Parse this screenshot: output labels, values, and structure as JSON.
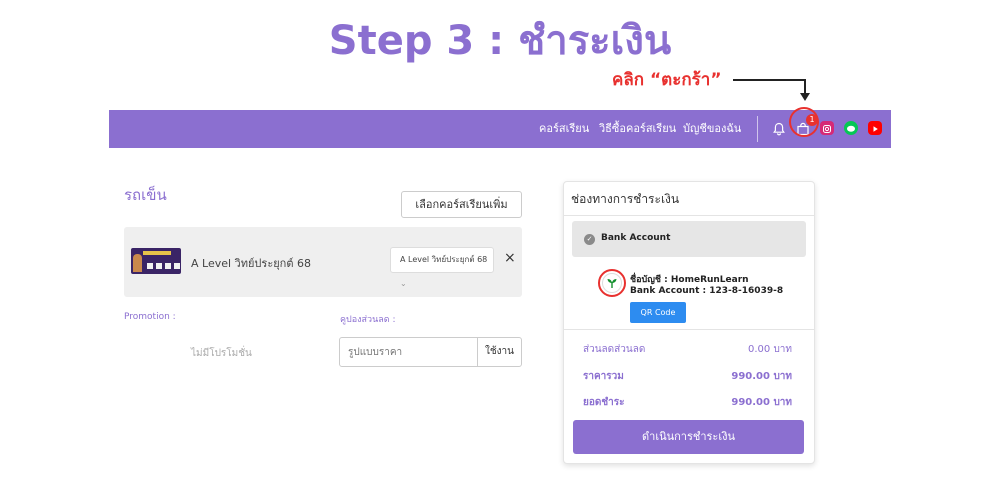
{
  "heading": {
    "title": "Step 3 : ชำระเงิน"
  },
  "annotation": {
    "text": "คลิก “ตะกร้า”",
    "color": "#e8312f"
  },
  "colors": {
    "brand": "#8b6fd0",
    "qr_button": "#2d8cf0"
  },
  "navbar": {
    "links": [
      "คอร์สเรียน",
      "วิธีซื้อคอร์สเรียน",
      "บัญชีของฉัน"
    ],
    "icons": [
      "bell-icon",
      "shopping-bag-icon",
      "instagram-icon",
      "line-icon",
      "youtube-icon"
    ],
    "cart_badge": "1"
  },
  "cart": {
    "title": "รถเข็น",
    "add_course_label": "เลือกคอร์สเรียนเพิ่ม",
    "item": {
      "name": "A Level วิทย์ประยุกต์ 68",
      "selected_option": "A Level วิทย์ประยุกต์ 68",
      "remove_label": "×"
    },
    "promotion_label": "Promotion :",
    "coupon_label": "คูปองส่วนลด :",
    "no_promotion_text": "ไม่มีโปรโมชั่น",
    "coupon_placeholder": "รูปแบบราคา",
    "apply_label": "ใช้งาน"
  },
  "payment": {
    "title": "ช่องทางการชำระเงิน",
    "method_label": "Bank Account",
    "account_name": "ชื่อบัญชี : HomeRunLearn",
    "account_number": "Bank Account : 123-8-16039-8",
    "qr_label": "QR Code",
    "summary": [
      {
        "label": "ส่วนลดส่วนลด",
        "value": "0.00 บาท"
      },
      {
        "label": "ราคารวม",
        "value": "990.00 บาท"
      },
      {
        "label": "ยอดชำระ",
        "value": "990.00 บาท"
      }
    ],
    "pay_label": "ดำเนินการชำระเงิน"
  }
}
